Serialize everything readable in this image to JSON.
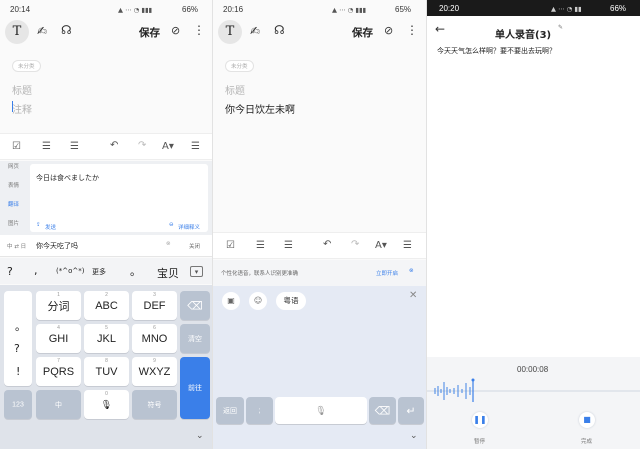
{
  "panel1": {
    "status_time": "20:14",
    "battery": "66%",
    "text_format_icon": "T",
    "save_label": "保存",
    "tag_label": "未分类",
    "title_placeholder": "标题",
    "body_placeholder": "注释",
    "side_menu": [
      "网页",
      "表情",
      "翻译",
      "图片"
    ],
    "translation_text": "今日は食べましたか",
    "send_label": "发送",
    "detail_label": "详细释义",
    "lang_pair": "中 ⇄ 日",
    "input_value": "你今天吃了吗",
    "close_label": "关闭",
    "candidates": [
      "?",
      ",",
      "(*^o^*)",
      "更多",
      "。",
      "宝贝"
    ],
    "keys_left": [
      "。",
      "?",
      "!"
    ],
    "keys": [
      {
        "num": "1",
        "label": "分词"
      },
      {
        "num": "2",
        "label": "ABC"
      },
      {
        "num": "3",
        "label": "DEF"
      },
      {
        "num": "4",
        "label": "GHI"
      },
      {
        "num": "5",
        "label": "JKL"
      },
      {
        "num": "6",
        "label": "MNO"
      },
      {
        "num": "7",
        "label": "PQRS"
      },
      {
        "num": "8",
        "label": "TUV"
      },
      {
        "num": "9",
        "label": "WXYZ"
      }
    ],
    "key_clear": "清空",
    "key_go": "前往",
    "key_123": "123",
    "key_cn": "中",
    "key_symbol": "符号",
    "key_zero": "0"
  },
  "panel2": {
    "status_time": "20:16",
    "battery": "65%",
    "text_format_icon": "T",
    "save_label": "保存",
    "tag_label": "未分类",
    "title_placeholder": "标题",
    "body_text": "你今日饮左未啊",
    "notice_text": "个性化语音，联系人识别更准确",
    "notice_action": "立即开启",
    "dialect_chip": "粤语",
    "key_back": "返回",
    "key_semicolon": ";"
  },
  "panel3": {
    "status_time": "20:20",
    "battery": "66%",
    "title": "单人录音(3)",
    "transcript": "今天天气怎么样啊？要不要出去玩啊？",
    "timer": "00:00:08",
    "pause_label": "暂停",
    "done_label": "完成"
  },
  "colors": {
    "accent": "#3a7fe9",
    "keyboard_bg": "#dfe3ea",
    "voice_bg": "#e5eaf4"
  }
}
